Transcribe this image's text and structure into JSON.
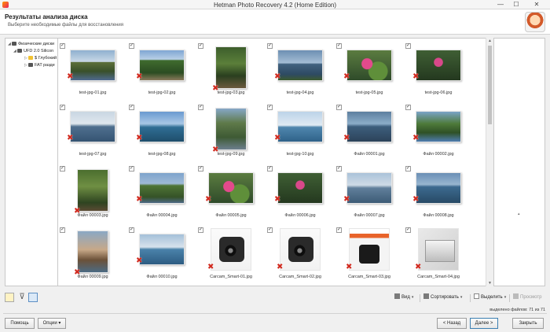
{
  "window": {
    "title": "Hetman Photo Recovery 4.2 (Home Edition)",
    "min": "—",
    "max": "☐",
    "close": "✕"
  },
  "header": {
    "title": "Результаты анализа диска",
    "subtitle": "Выберите необходимые файлы для восстановления"
  },
  "tree": {
    "items": [
      {
        "label": "Физические диски",
        "exp": "◢",
        "icon": "disk"
      },
      {
        "label": "UFD 2.0 Silicon",
        "exp": "◢",
        "icon": "disk"
      },
      {
        "label": "$ Глубокий",
        "exp": "▷",
        "icon": "folder"
      },
      {
        "label": "FAT разде",
        "exp": "▷",
        "icon": "disk"
      }
    ]
  },
  "files": [
    {
      "name": "test-jpg-01.jpg",
      "style": "p1"
    },
    {
      "name": "test-jpg-02.jpg",
      "style": "p2"
    },
    {
      "name": "test-jpg-03.jpg",
      "style": "p3",
      "tall": true
    },
    {
      "name": "test-jpg-04.jpg",
      "style": "p4"
    },
    {
      "name": "test-jpg-05.jpg",
      "style": "p5"
    },
    {
      "name": "test-jpg-06.jpg",
      "style": "p6"
    },
    {
      "name": "test-jpg-07.jpg",
      "style": "p7"
    },
    {
      "name": "test-jpg-08.jpg",
      "style": "p8"
    },
    {
      "name": "test-jpg-09.jpg",
      "style": "p9",
      "tall": true
    },
    {
      "name": "test-jpg-10.jpg",
      "style": "p10"
    },
    {
      "name": "Файл 00001.jpg",
      "style": "p11"
    },
    {
      "name": "Файл 00002.jpg",
      "style": "p12"
    },
    {
      "name": "Файл 00003.jpg",
      "style": "p13",
      "tall": true
    },
    {
      "name": "Файл 00004.jpg",
      "style": "p14"
    },
    {
      "name": "Файл 00005.jpg",
      "style": "p5"
    },
    {
      "name": "Файл 00006.jpg",
      "style": "p6"
    },
    {
      "name": "Файл 00007.jpg",
      "style": "p15"
    },
    {
      "name": "Файл 00008.jpg",
      "style": "p16"
    },
    {
      "name": "Файл 00009.jpg",
      "style": "p17",
      "tall": true
    },
    {
      "name": "Файл 00010.jpg",
      "style": "p18"
    },
    {
      "name": "Carcam_Smart-01.jpg",
      "style": "cam",
      "prod": true
    },
    {
      "name": "Carcam_Smart-02.jpg",
      "style": "cam",
      "prod": true
    },
    {
      "name": "Carcam_Smart-03.jpg",
      "style": "box",
      "prod": true
    },
    {
      "name": "Carcam_Smart-04.jpg",
      "style": "box2",
      "prod": true
    }
  ],
  "checkbox_mark": "✓",
  "deleted_mark": "✖",
  "toolbar": {
    "view": "Вид",
    "sort": "Сортировать",
    "select": "Выделить",
    "preview": "Просмотр",
    "dropdown": "▾"
  },
  "status": {
    "selected": "выделено файлов: 71 из 71"
  },
  "footer": {
    "help": "Помощь",
    "options": "Опции ▾",
    "back": "< Назад",
    "next": "Далее >",
    "close": "Закрыть"
  },
  "scroll": {
    "up": "▲",
    "down": "▼"
  },
  "rpanel_mark": "▴"
}
